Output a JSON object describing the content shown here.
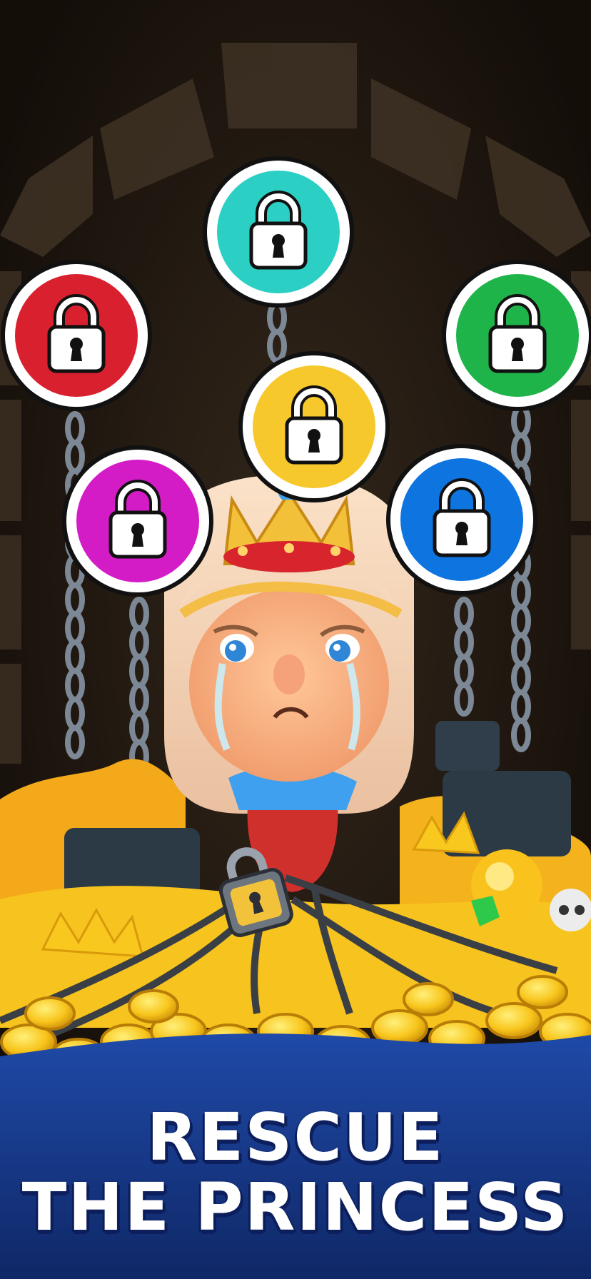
{
  "title": {
    "line1": "RESCUE",
    "line2": "THE PRINCESS"
  },
  "locks": [
    {
      "name": "teal",
      "color": "#2ccfc4",
      "state": "locked"
    },
    {
      "name": "red",
      "color": "#d8202f",
      "state": "locked"
    },
    {
      "name": "green",
      "color": "#1fb44a",
      "state": "locked"
    },
    {
      "name": "yellow",
      "color": "#f6c82c",
      "state": "locked"
    },
    {
      "name": "magenta",
      "color": "#d41cc6",
      "state": "locked"
    },
    {
      "name": "blue",
      "color": "#0d74e0",
      "state": "locked"
    }
  ],
  "colors": {
    "dungeon": "#1e1610",
    "stone": "#3d3023",
    "gold": "#f7c31e",
    "banner": "#173a8f"
  }
}
